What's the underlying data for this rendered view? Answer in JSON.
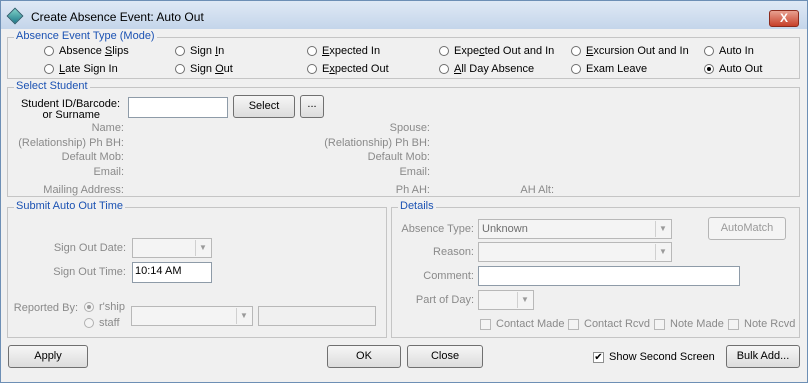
{
  "window": {
    "title": "Create Absence Event: Auto Out",
    "close_glyph": "X"
  },
  "mode_group": {
    "legend": "Absence Event Type (Mode)",
    "options": [
      {
        "label": "Absence Slips",
        "selected": false
      },
      {
        "label": "Sign In",
        "selected": false
      },
      {
        "label": "Expected In",
        "selected": false
      },
      {
        "label": "Expected Out and In",
        "selected": false
      },
      {
        "label": "Excursion Out and In",
        "selected": false
      },
      {
        "label": "Auto In",
        "selected": false
      },
      {
        "label": "Late Sign In",
        "selected": false
      },
      {
        "label": "Sign Out",
        "selected": false
      },
      {
        "label": "Expected Out",
        "selected": false
      },
      {
        "label": "All Day Absence",
        "selected": false
      },
      {
        "label": "Exam Leave",
        "selected": false
      },
      {
        "label": "Auto Out",
        "selected": true
      }
    ]
  },
  "student_group": {
    "legend": "Select Student",
    "id_label_1": "Student ID/Barcode:",
    "id_label_2": "or Surname",
    "id_value": "",
    "select_button": "Select",
    "browse_button": "...",
    "left_labels": {
      "name": "Name:",
      "ph_bh": "(Relationship) Ph BH:",
      "default_mob": "Default Mob:",
      "email": "Email:",
      "mailing": "Mailing Address:"
    },
    "right_labels": {
      "spouse": "Spouse:",
      "ph_bh": "(Relationship) Ph BH:",
      "default_mob": "Default Mob:",
      "email": "Email:",
      "ph_ah": "Ph AH:",
      "ah_alt": "AH Alt:"
    }
  },
  "auto_out_group": {
    "legend": "Submit Auto Out Time",
    "sign_out_date_label": "Sign Out Date:",
    "sign_out_date_value": "",
    "sign_out_time_label": "Sign Out Time:",
    "sign_out_time_value": "10:14 AM",
    "reported_by_label": "Reported By:",
    "rship_label": "r'ship",
    "staff_label": "staff",
    "rship_selected": true
  },
  "details_group": {
    "legend": "Details",
    "absence_type_label": "Absence Type:",
    "absence_type_value": "Unknown",
    "reason_label": "Reason:",
    "reason_value": "",
    "comment_label": "Comment:",
    "comment_value": "",
    "part_of_day_label": "Part of Day:",
    "part_of_day_value": "",
    "automatch_button": "AutoMatch",
    "checks": [
      {
        "label": "Contact Made",
        "checked": false
      },
      {
        "label": "Contact Rcvd",
        "checked": false
      },
      {
        "label": "Note Made",
        "checked": false
      },
      {
        "label": "Note Rcvd",
        "checked": false
      }
    ]
  },
  "footer": {
    "apply": "Apply",
    "ok": "OK",
    "close": "Close",
    "show_second_screen": "Show Second Screen",
    "show_second_screen_checked": true,
    "bulk_add": "Bulk Add...",
    "check_glyph": "✔"
  }
}
